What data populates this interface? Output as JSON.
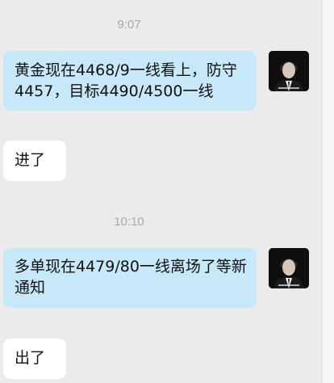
{
  "messages": [
    {
      "type": "timestamp",
      "text": "9:07"
    },
    {
      "type": "outgoing",
      "text": "黄金现在4468/9一线看上，防守4457，目标4490/4500一线",
      "avatar": "profile-photo"
    },
    {
      "type": "incoming",
      "text": "进了"
    },
    {
      "type": "timestamp",
      "text": "10:10"
    },
    {
      "type": "outgoing",
      "text": "多单现在4479/80一线离场了等新通知",
      "avatar": "profile-photo"
    },
    {
      "type": "incoming",
      "text": "出了"
    }
  ],
  "colors": {
    "background": "#ebebeb",
    "outgoing_bubble": "#c7e8f8",
    "incoming_bubble": "#ffffff",
    "timestamp_text": "#a8a8a8"
  }
}
